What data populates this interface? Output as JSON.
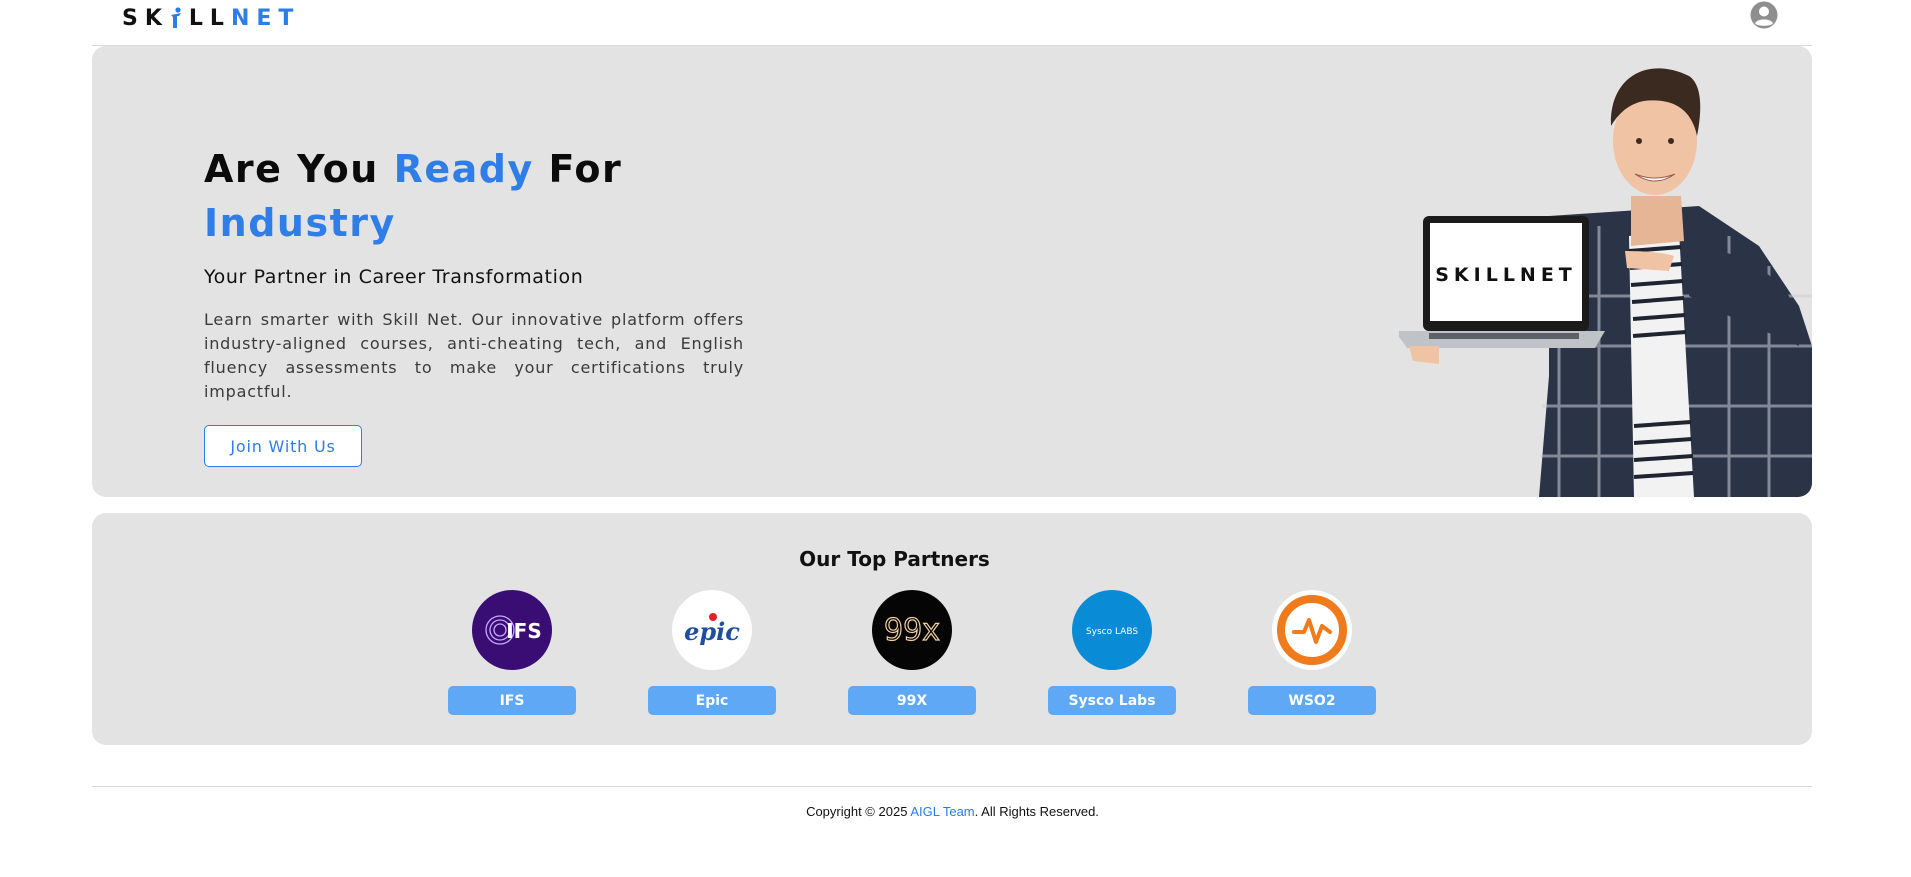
{
  "header": {
    "logo": {
      "part_a": "SK",
      "part_b": "LL",
      "part_c": "NET"
    },
    "avatar_icon": "user-circle-icon"
  },
  "hero": {
    "title_word1": "Are You ",
    "title_accent": "Ready",
    "title_word2": " For",
    "title_line2": "Industry",
    "subtitle": "Your Partner in Career Transformation",
    "body": "Learn smarter with Skill Net. Our innovative platform offers industry-aligned courses, anti-cheating tech, and English fluency assessments to make your certifications truly impactful.",
    "cta_label": "Join With Us",
    "laptop_logo": "SKILLNET"
  },
  "partners": {
    "title": "Our Top Partners",
    "items": [
      {
        "label": "IFS",
        "logo_text": "IFS",
        "bg": "#3a0d74"
      },
      {
        "label": "Epic",
        "logo_text": "epic",
        "bg": "#ffffff"
      },
      {
        "label": "99X",
        "logo_text": "99x",
        "bg": "#050505"
      },
      {
        "label": "Sysco Labs",
        "logo_text": "Sysco LABS",
        "bg": "#0a8bd6"
      },
      {
        "label": "WSO2",
        "logo_text": "",
        "bg": "#ffffff"
      }
    ]
  },
  "footer": {
    "prefix": "Copyright © 2025 ",
    "team": "AIGL Team",
    "suffix": ". All Rights Reserved."
  },
  "colors": {
    "accent": "#2f7ee8",
    "panel": "#e3e3e4",
    "tag": "#5ea8f5"
  }
}
